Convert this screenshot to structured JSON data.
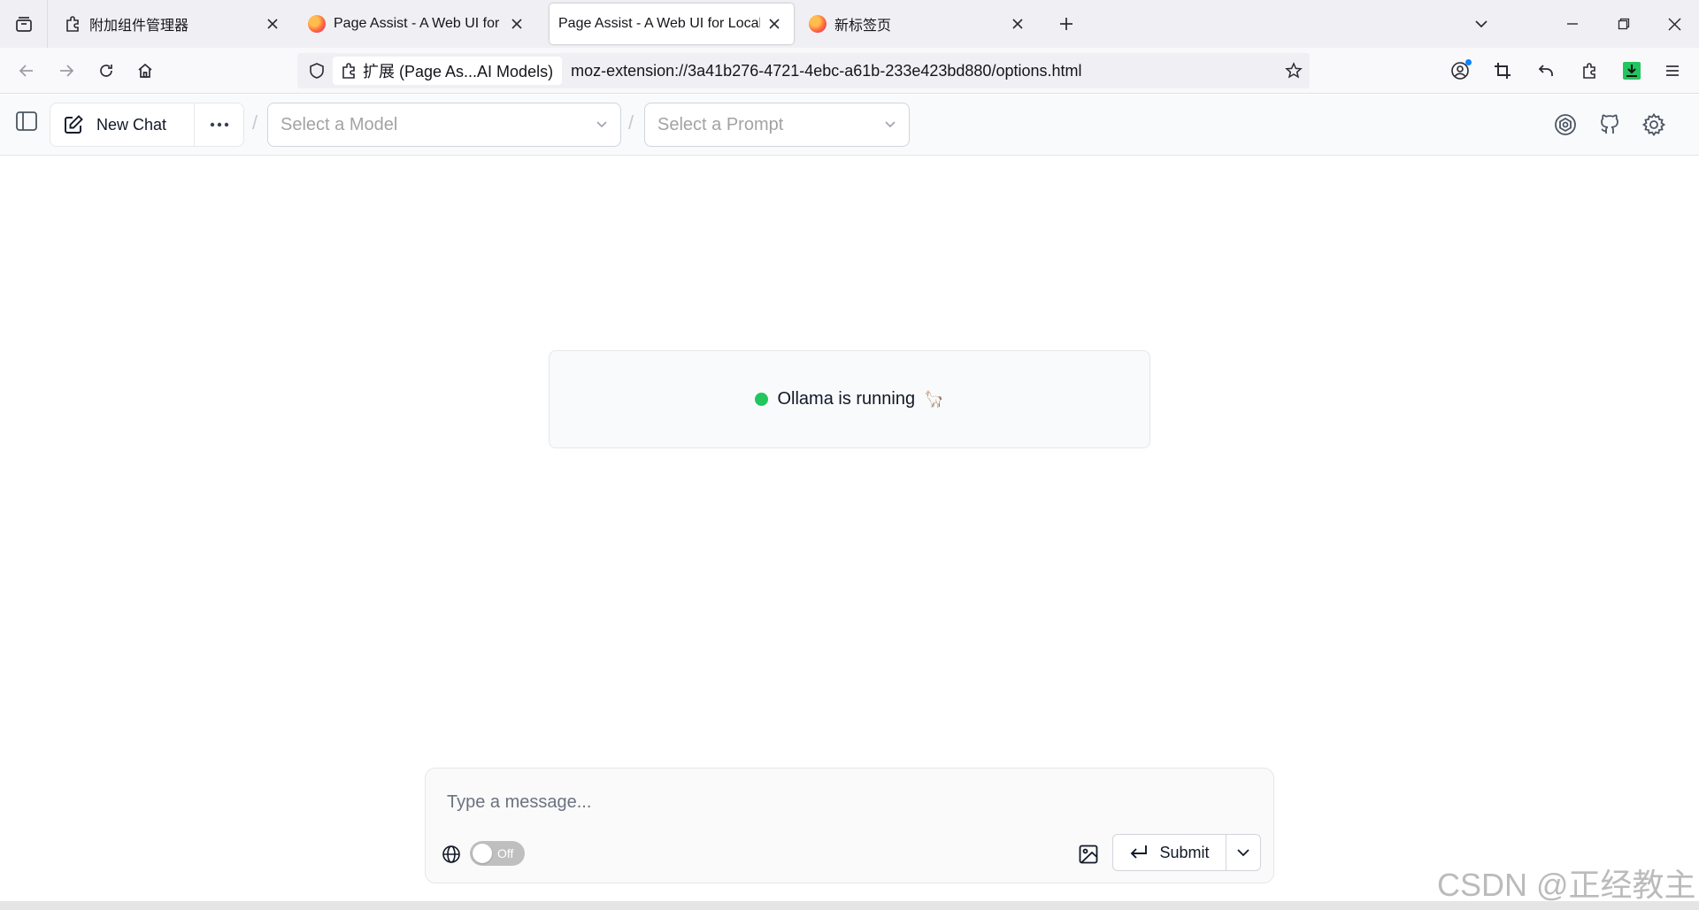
{
  "browser": {
    "tabs": [
      {
        "label": "附加组件管理器",
        "icon": "puzzle-icon",
        "active": false
      },
      {
        "label": "Page Assist - A Web UI for Lo",
        "icon": "firefox-icon",
        "active": false
      },
      {
        "label": "Page Assist - A Web UI for Local",
        "icon": "firefox-icon",
        "active": true
      },
      {
        "label": "新标签页",
        "icon": "firefox-icon",
        "active": false
      }
    ],
    "identity_label": "扩展 (Page As...AI Models)",
    "url": "moz-extension://3a41b276-4721-4ebc-a61b-233e423bd880/options.html"
  },
  "header": {
    "new_chat_label": "New Chat",
    "separator": "/",
    "model_placeholder": "Select a Model",
    "prompt_placeholder": "Select a Prompt"
  },
  "status": {
    "text": "Ollama is running",
    "emoji": "🦙",
    "color": "#22c55e"
  },
  "composer": {
    "placeholder": "Type a message...",
    "toggle_label": "Off",
    "submit_label": "Submit"
  },
  "watermark": "CSDN @正经教主",
  "colors": {
    "accent_status": "#22c55e",
    "toggle_off": "#bfbfbf",
    "download_icon": "#22c55e"
  }
}
